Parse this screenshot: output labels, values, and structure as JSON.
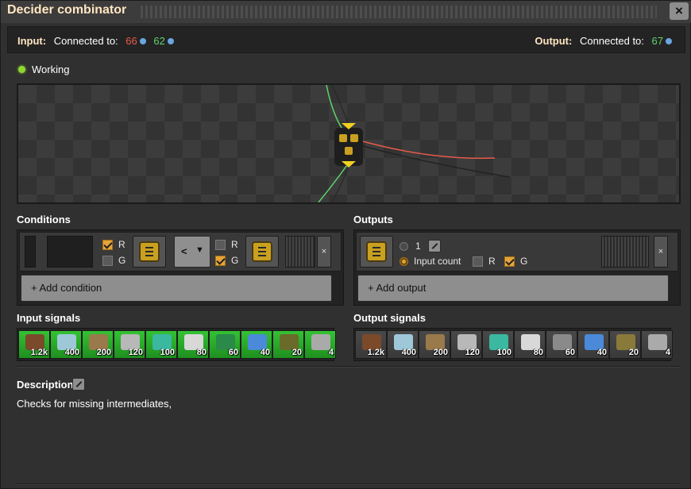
{
  "window": {
    "title": "Decider combinator",
    "close_label": "×"
  },
  "connections": {
    "input_label": "Input:",
    "input_connected": "Connected to:",
    "input_red": "66",
    "input_green": "62",
    "output_label": "Output:",
    "output_connected": "Connected to:",
    "output_green": "67"
  },
  "status": {
    "text": "Working",
    "color": "#8fd830"
  },
  "conditions": {
    "label": "Conditions",
    "first": {
      "left_r": {
        "label": "R",
        "checked": true
      },
      "left_g": {
        "label": "G",
        "checked": false
      },
      "left_signal_icon": "decider-combinator-icon",
      "comparator": "<",
      "right_r": {
        "label": "R",
        "checked": false
      },
      "right_g": {
        "label": "G",
        "checked": true
      },
      "right_signal_icon": "decider-combinator-icon",
      "remove_label": "×"
    },
    "add_label": "+ Add condition"
  },
  "outputs": {
    "label": "Outputs",
    "first": {
      "signal_icon": "decider-combinator-icon",
      "constant_value": "1",
      "input_count_label": "Input count",
      "r_label": "R",
      "g_label": "G",
      "remove_label": "×"
    },
    "add_label": "+ Add output"
  },
  "input_signals": {
    "label": "Input signals",
    "items": [
      {
        "icon": "stone-icon",
        "count": "1.2k",
        "color": "#7a4a2a"
      },
      {
        "icon": "glass-icon",
        "count": "400",
        "color": "#9ec8d8"
      },
      {
        "icon": "wood-planks-icon",
        "count": "200",
        "color": "#9a7a4a"
      },
      {
        "icon": "steel-plate-icon",
        "count": "120",
        "color": "#b8b8b8"
      },
      {
        "icon": "gauge-icon",
        "count": "100",
        "color": "#3ab8a0"
      },
      {
        "icon": "concrete-icon",
        "count": "80",
        "color": "#d8d8d8"
      },
      {
        "icon": "circuit-icon",
        "count": "60",
        "color": "#2a8a4a"
      },
      {
        "icon": "crystal-icon",
        "count": "40",
        "color": "#4a8ad8"
      },
      {
        "icon": "battery-icon",
        "count": "20",
        "color": "#6a6a2a"
      },
      {
        "icon": "gears-icon",
        "count": "4",
        "color": "#aaaaaa"
      }
    ]
  },
  "output_signals": {
    "label": "Output signals",
    "items": [
      {
        "icon": "stone-icon",
        "count": "1.2k",
        "color": "#7a4a2a"
      },
      {
        "icon": "glass-icon",
        "count": "400",
        "color": "#9ec8d8"
      },
      {
        "icon": "wood-planks-icon",
        "count": "200",
        "color": "#9a7a4a"
      },
      {
        "icon": "steel-plate-icon",
        "count": "120",
        "color": "#b8b8b8"
      },
      {
        "icon": "gauge-icon",
        "count": "100",
        "color": "#3ab8a0"
      },
      {
        "icon": "concrete-icon",
        "count": "80",
        "color": "#d8d8d8"
      },
      {
        "icon": "circuit-icon",
        "count": "60",
        "color": "#8a8a8a"
      },
      {
        "icon": "crystal-icon",
        "count": "40",
        "color": "#4a8ad8"
      },
      {
        "icon": "battery-icon",
        "count": "20",
        "color": "#8a7a3a"
      },
      {
        "icon": "gears-icon",
        "count": "4",
        "color": "#aaaaaa"
      }
    ]
  },
  "description": {
    "label": "Description",
    "text": "Checks for missing intermediates,"
  },
  "colors": {
    "accent": "#ffe6c0",
    "red_wire": "#e85a4a",
    "green_wire": "#5fd46a",
    "checked": "#e4a43a"
  }
}
